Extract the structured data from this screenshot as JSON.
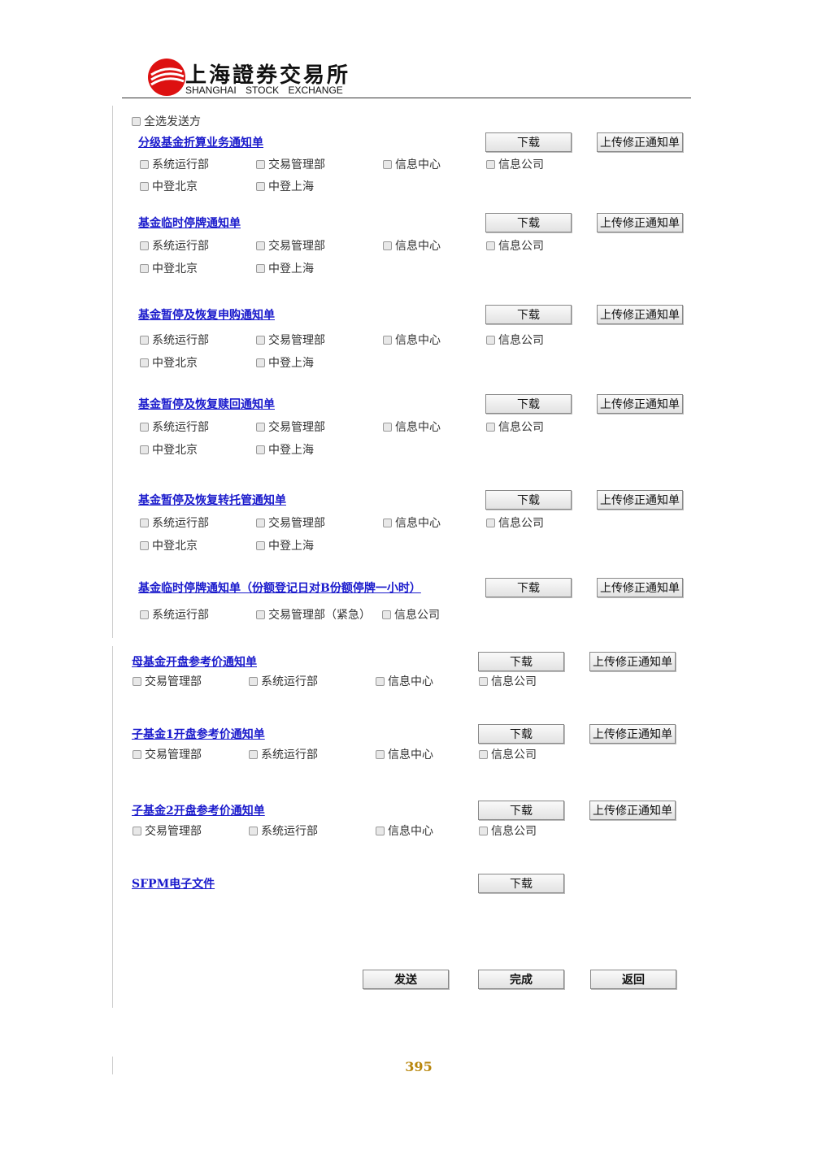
{
  "logo": {
    "cn": "上海證券交易所",
    "en": "SHANGHAI STOCK EXCHANGE"
  },
  "select_all": "全选发送方",
  "download": "下载",
  "upload": "上传修正通知单",
  "recipients": {
    "sys": "系统运行部",
    "trade": "交易管理部",
    "info": "信息中心",
    "infoco": "信息公司",
    "bj": "中登北京",
    "sh": "中登上海",
    "trade_urgent": "交易管理部（紧急）"
  },
  "sections": [
    "分级基金折算业务通知单",
    "基金临时停牌通知单",
    "基金暂停及恢复申购通知单",
    "基金暂停及恢复赎回通知单",
    "基金暂停及恢复转托管通知单",
    "基金临时停牌通知单（份额登记日对B份额停牌一小时）",
    "母基金开盘参考价通知单",
    "子基金1开盘参考价通知单",
    "子基金2开盘参考价通知单",
    "SFPM电子文件"
  ],
  "footer": {
    "send": "发送",
    "done": "完成",
    "back": "返回"
  },
  "page_number": "395",
  "colors": {
    "link": "#1a1acc",
    "logo_red": "#d11",
    "page_number": "#b8860b"
  }
}
